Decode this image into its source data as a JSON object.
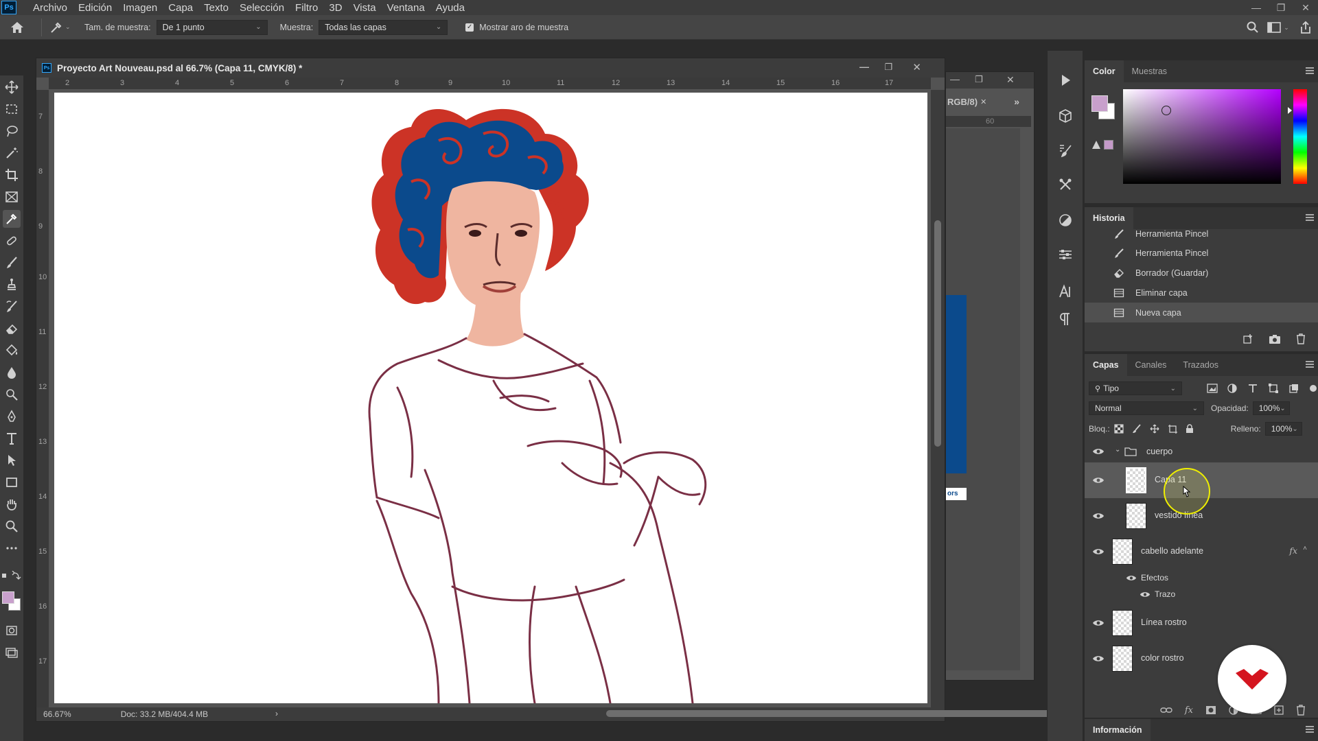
{
  "app": {
    "logo": "Ps",
    "menu": [
      "Archivo",
      "Edición",
      "Imagen",
      "Capa",
      "Texto",
      "Selección",
      "Filtro",
      "3D",
      "Vista",
      "Ventana",
      "Ayuda"
    ]
  },
  "options": {
    "sample_size_label": "Tam. de muestra:",
    "sample_size_value": "De 1 punto",
    "sample_label": "Muestra:",
    "sample_value": "Todas las capas",
    "show_ring_label": "Mostrar aro de muestra",
    "show_ring_checked": true
  },
  "document": {
    "title": "Proyecto Art Nouveau.psd al 66.7% (Capa 11, CMYK/8) *",
    "ruler_h": [
      "2",
      "3",
      "4",
      "5",
      "6",
      "7",
      "8",
      "9",
      "10",
      "11",
      "12",
      "13",
      "14",
      "15",
      "16",
      "17"
    ],
    "ruler_v": [
      "7",
      "8",
      "9",
      "10",
      "11",
      "12",
      "13",
      "14",
      "15",
      "16",
      "17"
    ],
    "zoom": "66.67%",
    "doc_info": "Doc: 33.2 MB/404.4 MB"
  },
  "background_document": {
    "title_fragment": "RGB/8)",
    "ruler_fragment": "60",
    "label_fragment": "ors"
  },
  "panels": {
    "color": {
      "tabs": [
        "Color",
        "Muestras"
      ],
      "foreground": "#c8a0cc",
      "background": "#ffffff",
      "gamut_swatch": "#c49ac8"
    },
    "history": {
      "title": "Historia",
      "items": [
        {
          "label": "Herramienta Pincel",
          "icon": "brush-icon"
        },
        {
          "label": "Herramienta Pincel",
          "icon": "brush-icon"
        },
        {
          "label": "Borrador (Guardar)",
          "icon": "eraser-icon"
        },
        {
          "label": "Eliminar capa",
          "icon": "layer-icon"
        },
        {
          "label": "Nueva capa",
          "icon": "layer-icon"
        }
      ]
    },
    "layers": {
      "tabs": [
        "Capas",
        "Canales",
        "Trazados"
      ],
      "filter": "Tipo",
      "blend_mode": "Normal",
      "opacity_label": "Opacidad:",
      "opacity_value": "100%",
      "lock_label": "Bloq.:",
      "fill_label": "Relleno:",
      "fill_value": "100%",
      "items": [
        {
          "name": "cuerpo",
          "kind": "group"
        },
        {
          "name": "Capa 11",
          "kind": "layer",
          "selected": true
        },
        {
          "name": "vestido línea",
          "kind": "layer"
        },
        {
          "name": "cabello adelante",
          "kind": "layer",
          "fx": "fx"
        },
        {
          "name": "Efectos",
          "kind": "effects"
        },
        {
          "name": "Trazo",
          "kind": "effect"
        },
        {
          "name": "Línea rostro",
          "kind": "layer"
        },
        {
          "name": "color rostro",
          "kind": "layer"
        }
      ]
    },
    "info": {
      "title": "Información"
    }
  },
  "colors": {
    "ui_dark": "#2b2b2b",
    "ui_panel": "#3c3c3c",
    "hair_red": "#cc3326",
    "hair_blue": "#0b4a8c",
    "skin": "#efb5a0",
    "sketch": "#7a2f45",
    "brand_red": "#d4151f"
  }
}
